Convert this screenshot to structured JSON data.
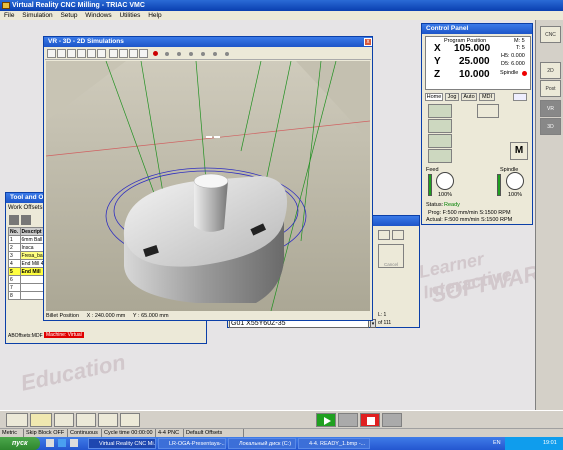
{
  "app": {
    "title": "Virtual Reality CNC Milling - TRIAC VMC"
  },
  "menu": [
    "File",
    "Simulation",
    "Setup",
    "Windows",
    "Utilities",
    "Help"
  ],
  "watermark": {
    "lines": [
      "Learner Interactive",
      "SOFTWARE",
      "Education"
    ]
  },
  "right_toolbar": {
    "buttons": [
      "CNC",
      "2D",
      "Post",
      "VR",
      "3D"
    ]
  },
  "control_panel": {
    "title": "Control Panel",
    "program_position_label": "Program Position",
    "m_code": "M: 5",
    "t_code": "T: 5",
    "h_code": "H5: 0.000",
    "d_code": "D5: 6.000",
    "spindle_label": "Spindle",
    "axes": [
      {
        "name": "X",
        "value": "105.000"
      },
      {
        "name": "Y",
        "value": "25.000"
      },
      {
        "name": "Z",
        "value": "10.000"
      }
    ],
    "tabs": [
      "Home",
      "Jog",
      "Auto",
      "MDI"
    ],
    "feed_label": "Feed",
    "spindle_override_label": "Spindle",
    "feed_pct": "100%",
    "spindle_pct": "100%",
    "status_label": "Status:",
    "status_value": "Ready",
    "prog_line": "Prog: F:500 mm/min   S:1500 RPM",
    "actual_line": "Actual: F:500 mm/min   S:1500 RPM",
    "m_button": "M"
  },
  "vr_window": {
    "title": "VR - 3D - 2D Simulations",
    "billet_label": "Billet Position",
    "billet_x": "X : 240.000 mm",
    "billet_y": "Y : 65.000 mm"
  },
  "tool_window": {
    "title": "Tool and Offs",
    "tab": "Work Offsets",
    "header": [
      "No.",
      "Descript"
    ],
    "rows": [
      {
        "no": "1",
        "desc": "6mm Ball"
      },
      {
        "no": "2",
        "desc": "Insca"
      },
      {
        "no": "3",
        "desc": "Fresa_ba"
      },
      {
        "no": "4",
        "desc": "End Mill 4"
      },
      {
        "no": "5",
        "desc": "End Mill"
      },
      {
        "no": "6",
        "desc": ""
      },
      {
        "no": "7",
        "desc": ""
      },
      {
        "no": "8",
        "desc": ""
      }
    ],
    "abs_label": "ABOffsets:MDF",
    "machine_label": "Machine: Virtual"
  },
  "mdi_window": {
    "command": "G01 X55Y60Z-35",
    "count": "of 111",
    "line": "L: 1",
    "button_label": "Cancel"
  },
  "statusbar": [
    "Metric",
    "Skip Block OFF",
    "Continuous",
    "Cycle time 00:00:00",
    "4-4 PNC",
    "Default Offsets"
  ],
  "taskbar": {
    "start": "пуск",
    "tasks": [
      "Virtual Reality CNC Mi...",
      "LR-OGA-Presentaya-...",
      "Локальный диск (C:)",
      "4-4. READY_1.bmp -..."
    ],
    "lang": "EN",
    "clock": "19:01"
  },
  "colors": {
    "accent": "#1d55c8",
    "ready": "#008000",
    "machine": "#e00000"
  }
}
